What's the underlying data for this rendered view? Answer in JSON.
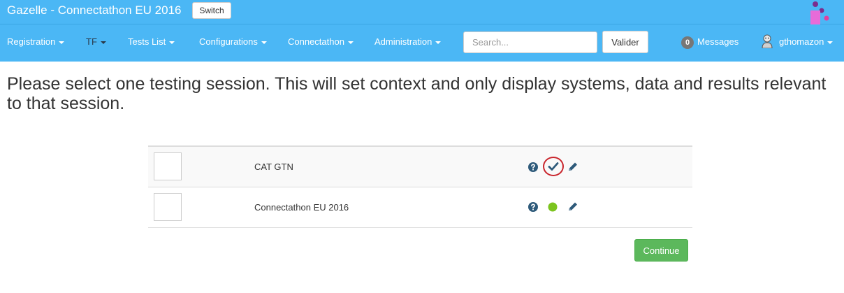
{
  "header": {
    "app_title": "Gazelle - Connectathon EU 2016",
    "switch_label": "Switch"
  },
  "nav": {
    "items": [
      {
        "label": "Registration"
      },
      {
        "label": "TF"
      },
      {
        "label": "Tests List"
      },
      {
        "label": "Configurations"
      },
      {
        "label": "Connectathon"
      },
      {
        "label": "Administration"
      }
    ],
    "search": {
      "placeholder": "Search...",
      "value": ""
    },
    "valider_label": "Valider",
    "messages": {
      "count": "0",
      "label": "Messages"
    },
    "user": {
      "name": "gthomazon"
    }
  },
  "main": {
    "headline": "Please select one testing session. This will set context and only display systems, data and results relevant to that session.",
    "sessions": [
      {
        "name": "CAT GTN",
        "status": "checked",
        "highlighted": true
      },
      {
        "name": "Connectathon EU 2016",
        "status": "active",
        "highlighted": false
      }
    ],
    "continue_label": "Continue"
  },
  "colors": {
    "navbar": "#4bb7f5",
    "continue": "#5cb85c",
    "icon": "#2e5a7a",
    "active_dot": "#7cc41f",
    "highlight": "#c9252c",
    "badge": "#777777"
  },
  "icons": [
    "question-circle-icon",
    "checkmark-icon",
    "pencil-icon",
    "green-dot-icon",
    "user-avatar-icon",
    "caret-down-icon",
    "gazelle-logo"
  ]
}
